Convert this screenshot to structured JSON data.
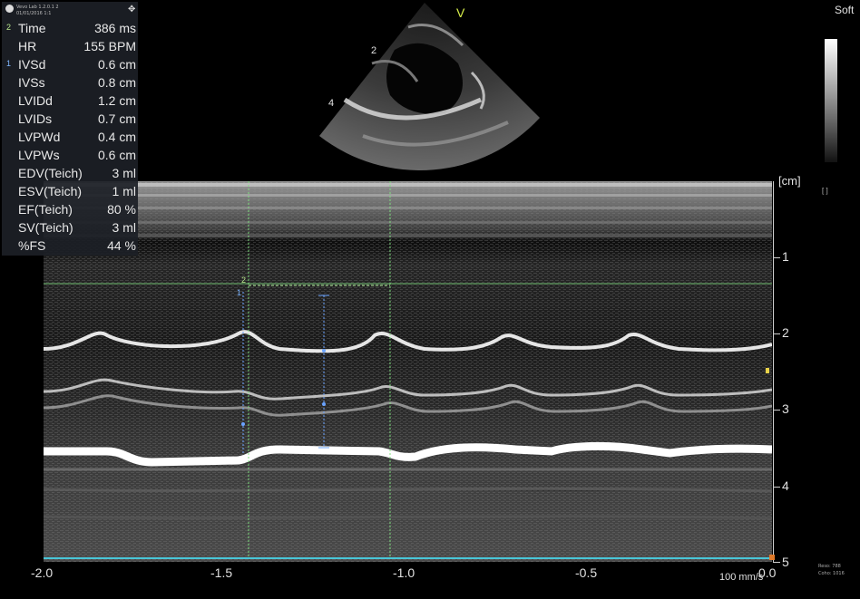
{
  "panel": {
    "header_line1": "Vevo Lab 1.2.0.1 2",
    "header_line2": "01/01/2016 1:1",
    "rows": [
      {
        "idx": "2",
        "label": "Time",
        "value": "386 ms"
      },
      {
        "idx": "",
        "label": "HR",
        "value": "155 BPM"
      },
      {
        "idx": "1",
        "label": "IVSd",
        "value": "0.6 cm"
      },
      {
        "idx": "",
        "label": "IVSs",
        "value": "0.8 cm"
      },
      {
        "idx": "",
        "label": "LVIDd",
        "value": "1.2 cm"
      },
      {
        "idx": "",
        "label": "LVIDs",
        "value": "0.7 cm"
      },
      {
        "idx": "",
        "label": "LVPWd",
        "value": "0.4 cm"
      },
      {
        "idx": "",
        "label": "LVPWs",
        "value": "0.6 cm"
      },
      {
        "idx": "",
        "label": "EDV(Teich)",
        "value": "3 ml"
      },
      {
        "idx": "",
        "label": "ESV(Teich)",
        "value": "1 ml"
      },
      {
        "idx": "",
        "label": "EF(Teich)",
        "value": "80 %"
      },
      {
        "idx": "",
        "label": "SV(Teich)",
        "value": "3 ml"
      },
      {
        "idx": "",
        "label": "%FS",
        "value": "44 %"
      }
    ]
  },
  "sector": {
    "label_v": "V",
    "label_2": "2",
    "label_4": "4"
  },
  "top_right": {
    "soft": "Soft",
    "bracket": "[ ]"
  },
  "depth_axis": {
    "unit_label": "[cm]",
    "labels": [
      "1",
      "2",
      "3",
      "4",
      "5"
    ]
  },
  "time_axis": {
    "labels": [
      "-2.0",
      "-1.5",
      "-1.0",
      "-0.5",
      "0.0"
    ],
    "speed": "100 mm/s"
  },
  "bottom_info": {
    "line1": "Reso: 788",
    "line2": "Coho: 1016"
  },
  "colors": {
    "caliper_green": "#7fe07f",
    "caliper_blue": "#6aa3ff",
    "baseline_cyan": "#49c6d8",
    "v_label": "#d7ef4a"
  }
}
